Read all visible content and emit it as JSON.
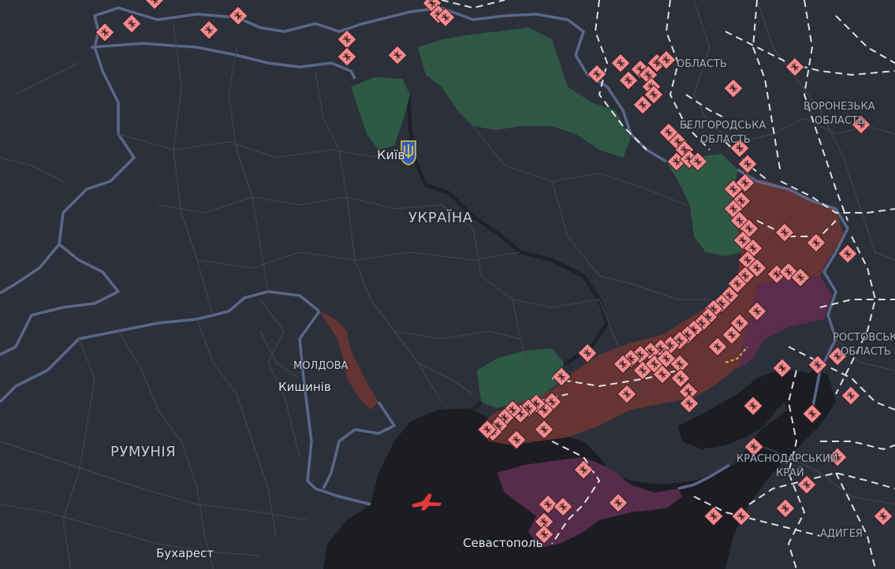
{
  "labels": {
    "ukraine": "УКРАЇНА",
    "kyiv": "Київ",
    "romania": "РУМУНІЯ",
    "moldova": "МОЛДОВА",
    "chisinau": "Кишинів",
    "bucharest": "Бухарест",
    "sevastopol": "Севастополь",
    "belgorod_line1": "БЕЛГОРОДСЬКА",
    "belgorod_line2": "ОБЛАСТЬ",
    "kursk": "ОБЛАСТЬ",
    "voronezh_line1": "ВОРОНЕЗЬКА",
    "voronezh_line2": "ОБЛАСТЬ",
    "rostov_line1": "РОСТОВСЬКА",
    "rostov_line2": "ОБЛАСТЬ",
    "krasnodar_line1": "КРАСНОДАРСЬКИЙ",
    "krasnodar_line2": "КРАЙ",
    "adygea": "АДИГЕЯ"
  },
  "legend_colors": {
    "land": "#2c303a",
    "sea": "#1b1d22",
    "border": "#5a6788",
    "occupied": "#6a3533",
    "crimea": "#5b2c4d",
    "liberated": "#2f5d47",
    "marker": "#f28b8e",
    "railway": "#ffffff"
  },
  "icons": {
    "kyiv": "trident-emblem-icon",
    "incident": "aircraft-icon",
    "event_marker": "diamond-event-marker-icon"
  }
}
